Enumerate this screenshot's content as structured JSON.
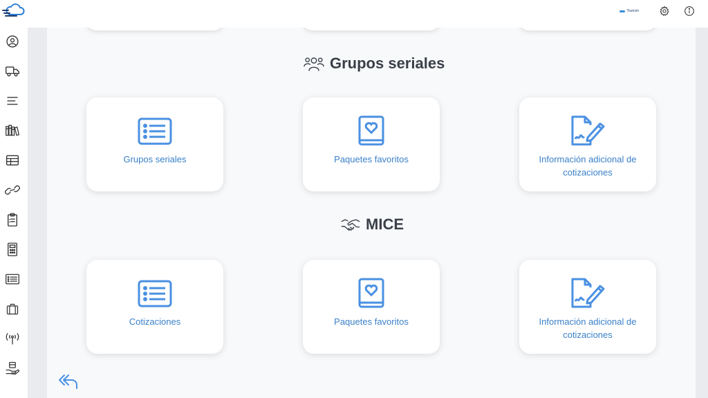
{
  "header": {
    "brand_mini": "Tourism",
    "icons": [
      "gear-icon",
      "info-icon"
    ]
  },
  "sidebar": {
    "icons": [
      "user-circle-icon",
      "truck-icon",
      "menu-lines-icon",
      "books-icon",
      "table-icon",
      "link-icon",
      "clipboard-icon",
      "calculator-icon",
      "list-icon",
      "suitcase-icon",
      "antenna-icon",
      "hand-box-icon"
    ]
  },
  "sections": [
    {
      "title": "Grupos seriales",
      "icon": "users-group-icon",
      "cards": [
        {
          "label": "Grupos seriales",
          "icon": "list-icon"
        },
        {
          "label": "Paquetes favoritos",
          "icon": "heart-book-icon"
        },
        {
          "label": "Información adicional de cotizaciones",
          "icon": "signed-document-icon"
        }
      ]
    },
    {
      "title": "MICE",
      "icon": "handshake-icon",
      "cards": [
        {
          "label": "Cotizaciones",
          "icon": "list-icon"
        },
        {
          "label": "Paquetes favoritos",
          "icon": "heart-book-icon"
        },
        {
          "label": "Información adicional de cotizaciones",
          "icon": "signed-document-icon"
        }
      ]
    }
  ],
  "colors": {
    "accent": "#4a90e2",
    "card_label": "#3a80c9",
    "title": "#3a3f48",
    "gutter": "#e9ebee"
  }
}
